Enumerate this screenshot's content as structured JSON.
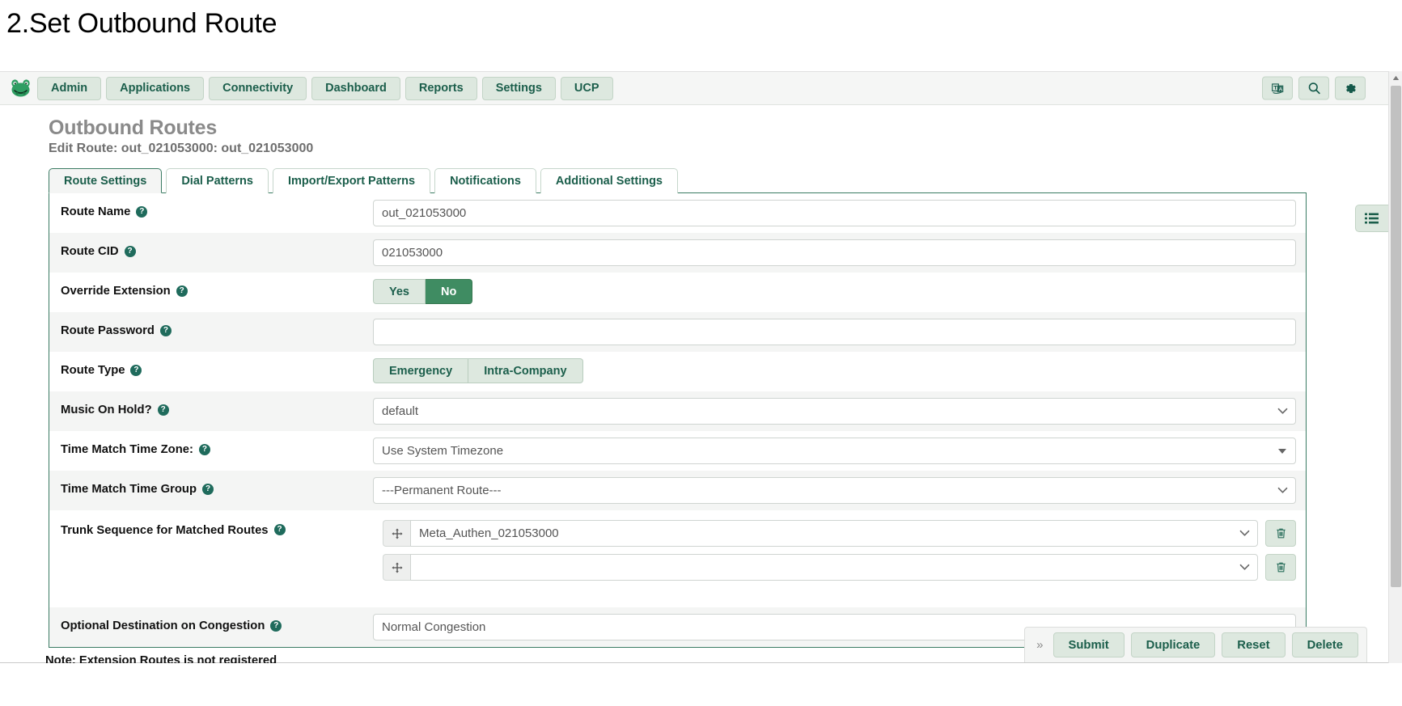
{
  "page_heading": "2.Set Outbound Route",
  "navbar": {
    "logo_alt": "FreePBX frog logo",
    "items": [
      {
        "label": "Admin"
      },
      {
        "label": "Applications"
      },
      {
        "label": "Connectivity"
      },
      {
        "label": "Dashboard"
      },
      {
        "label": "Reports"
      },
      {
        "label": "Settings"
      },
      {
        "label": "UCP"
      }
    ],
    "right_icons": [
      {
        "name": "translate-icon"
      },
      {
        "name": "search-icon"
      },
      {
        "name": "gear-icon"
      }
    ]
  },
  "header": {
    "title": "Outbound Routes",
    "subtitle": "Edit Route: out_021053000: out_021053000"
  },
  "tabs": [
    {
      "label": "Route Settings",
      "active": true
    },
    {
      "label": "Dial Patterns",
      "active": false
    },
    {
      "label": "Import/Export Patterns",
      "active": false
    },
    {
      "label": "Notifications",
      "active": false
    },
    {
      "label": "Additional Settings",
      "active": false
    }
  ],
  "form": {
    "route_name": {
      "label": "Route Name",
      "value": "out_021053000"
    },
    "route_cid": {
      "label": "Route CID",
      "value": "021053000"
    },
    "override_extension": {
      "label": "Override Extension",
      "options": [
        "Yes",
        "No"
      ],
      "selected": "No"
    },
    "route_password": {
      "label": "Route Password",
      "value": ""
    },
    "route_type": {
      "label": "Route Type",
      "options": [
        "Emergency",
        "Intra-Company"
      ],
      "selected": ""
    },
    "music_on_hold": {
      "label": "Music On Hold?",
      "value": "default"
    },
    "time_match_time_zone": {
      "label": "Time Match Time Zone:",
      "value": "Use System Timezone"
    },
    "time_match_time_group": {
      "label": "Time Match Time Group",
      "value": "---Permanent Route---"
    },
    "trunk_sequence": {
      "label": "Trunk Sequence for Matched Routes",
      "rows": [
        {
          "value": "Meta_Authen_021053000"
        },
        {
          "value": ""
        }
      ]
    },
    "optional_destination": {
      "label": "Optional Destination on Congestion",
      "value": "Normal Congestion"
    }
  },
  "note": "Note: Extension Routes is not registered",
  "side_button": {
    "name": "list-menu-icon"
  },
  "action_bar": {
    "expand_label": "»",
    "buttons": [
      {
        "label": "Submit"
      },
      {
        "label": "Duplicate"
      },
      {
        "label": "Reset"
      },
      {
        "label": "Delete"
      }
    ]
  },
  "colors": {
    "brand_green": "#1b5e4b",
    "accent_green": "#3f8c62",
    "nav_btn_bg": "#dde8df",
    "panel_border": "#3a7b63"
  }
}
